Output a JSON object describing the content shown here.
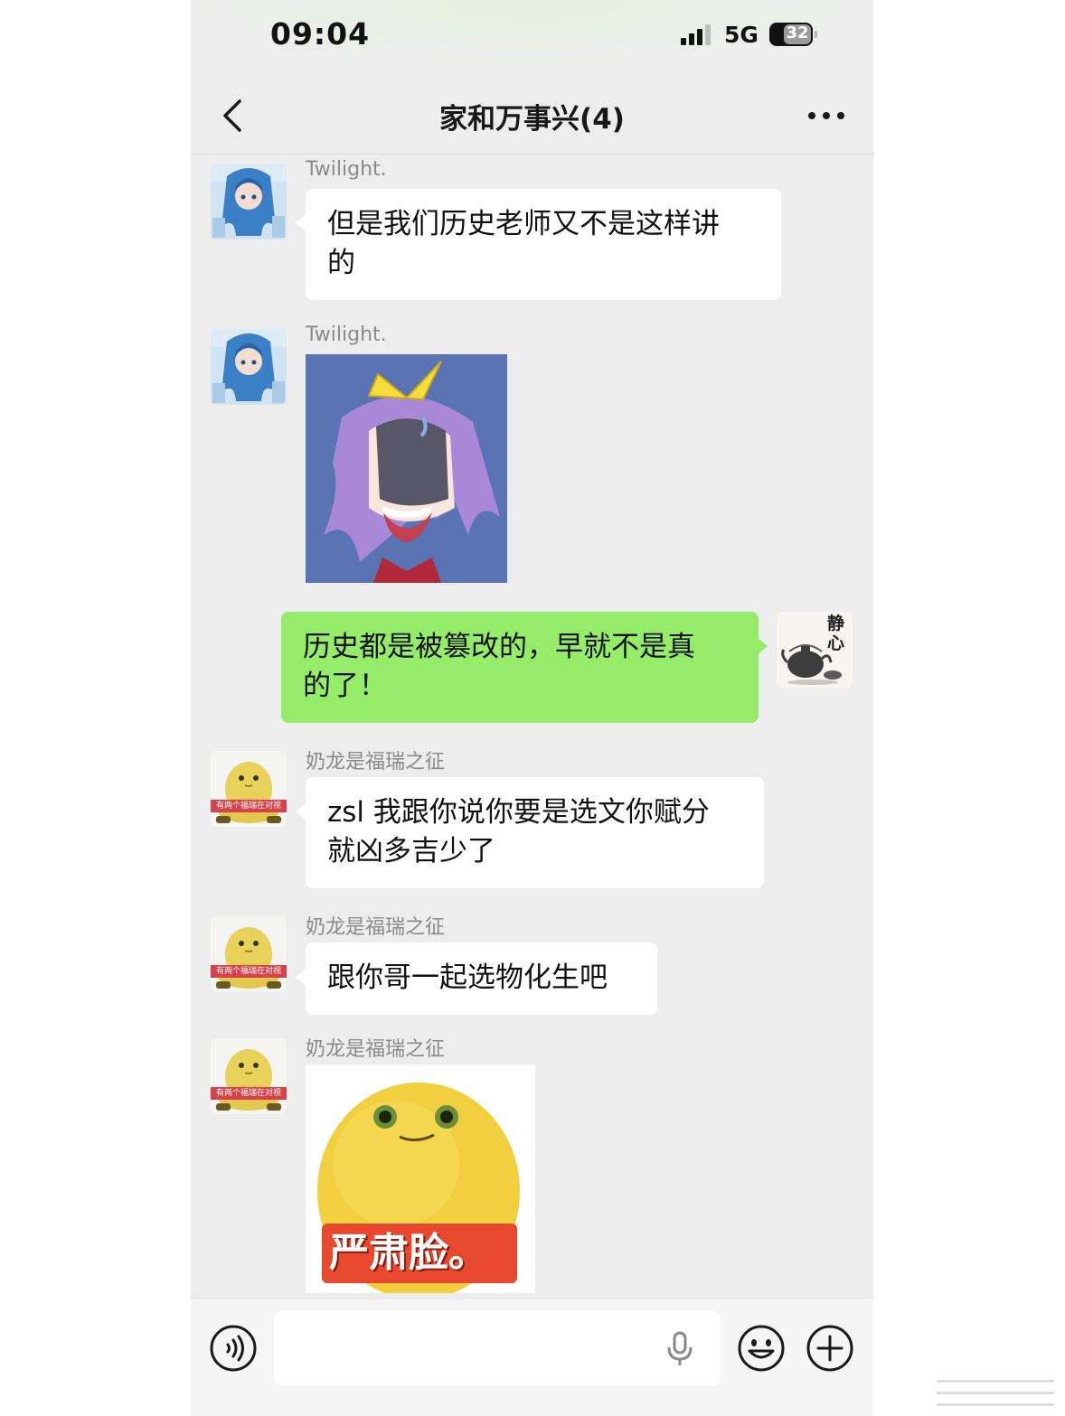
{
  "status_bar": {
    "time": "09:04",
    "network": "5G",
    "battery": "32"
  },
  "header": {
    "title": "家和万事兴(4)"
  },
  "messages": [
    {
      "sender": "Twilight.",
      "text_line1": "但是我们历史老师又不是这样讲",
      "text_line2": "的"
    },
    {
      "sender": "Twilight.",
      "sticker": "purple-hair-anime-girl-shocked-sticker"
    },
    {
      "self": true,
      "text_line1": "历史都是被篡改的，早就不是真",
      "text_line2": "的了！"
    },
    {
      "sender": "奶龙是福瑞之征",
      "text_line1": "zsl 我跟你说你要是选文你赋分",
      "text_line2": "就凶多吉少了"
    },
    {
      "sender": "奶龙是福瑞之征",
      "text_line1": "跟你哥一起选物化生吧"
    },
    {
      "sender": "奶龙是福瑞之征",
      "sticker": "yellow-blob-sticker",
      "sticker_caption": "严肃脸。"
    }
  ],
  "avatars": {
    "twilight": "anime-girl-blue-hair-avatar",
    "self": {
      "calligraphy": "静心",
      "image": "teapot-ink-painting-avatar"
    },
    "nailong": {
      "image": "yellow-frog-avatar",
      "badge": "有两个福瑞在对视"
    }
  },
  "input_bar": {
    "voice": "voice-icon",
    "mic": "microphone-icon",
    "emoji": "emoji-icon",
    "plus": "plus-icon"
  },
  "colors": {
    "chat_bg": "#ededed",
    "self_bubble": "#95ec69",
    "other_bubble": "#ffffff"
  }
}
